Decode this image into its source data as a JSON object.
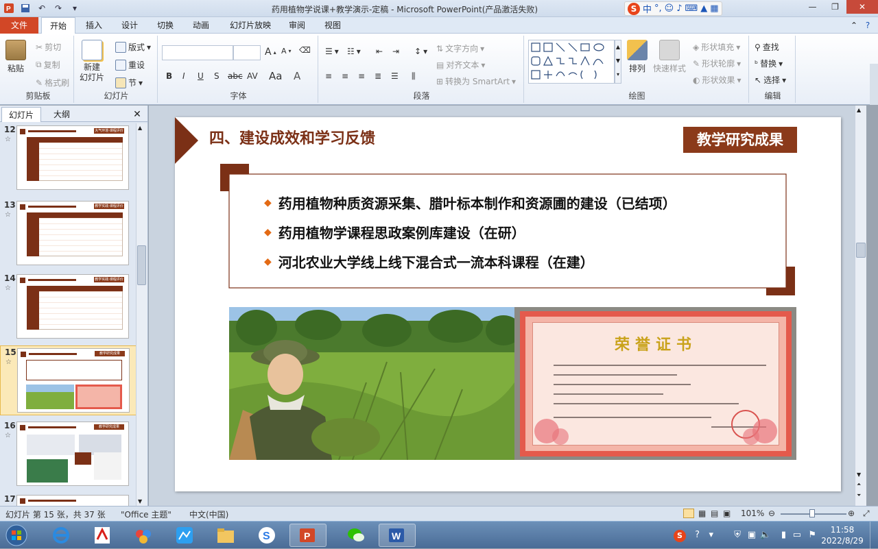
{
  "window": {
    "title": "药用植物学说课+教学演示-定稿 - Microsoft PowerPoint(产品激活失败)"
  },
  "ime": {
    "label1": "中",
    "label2": "°,"
  },
  "menu": {
    "tabs": [
      "文件",
      "开始",
      "插入",
      "设计",
      "切换",
      "动画",
      "幻灯片放映",
      "审阅",
      "视图"
    ],
    "active": "开始"
  },
  "ribbon": {
    "clipboard": {
      "paste": "粘贴",
      "cut": "剪切",
      "copy": "复制",
      "format_painter": "格式刷",
      "label": "剪贴板"
    },
    "slides": {
      "new_slide": "新建",
      "new_slide2": "幻灯片",
      "layout": "版式",
      "reset": "重设",
      "section": "节",
      "label": "幻灯片"
    },
    "font": {
      "label": "字体",
      "bold": "B",
      "italic": "I",
      "underline": "U",
      "shadow": "S",
      "strike": "abc",
      "spacing": "AV",
      "case": "Aa",
      "color": "A",
      "grow": "A",
      "shrink": "A"
    },
    "paragraph": {
      "text_direction": "文字方向",
      "align_text": "对齐文本",
      "smartart": "转换为 SmartArt",
      "label": "段落"
    },
    "drawing": {
      "arrange": "排列",
      "quick_styles": "快速样式",
      "fill": "形状填充",
      "outline": "形状轮廓",
      "effects": "形状效果",
      "label": "绘图"
    },
    "editing": {
      "find": "查找",
      "replace": "替换",
      "select": "选择",
      "label": "编辑"
    }
  },
  "left_pane": {
    "tabs": [
      "幻灯片",
      "大纲"
    ],
    "slides": [
      {
        "num": "12",
        "star": "☆",
        "selected": false,
        "badge": "大气环境·课程评价"
      },
      {
        "num": "13",
        "star": "☆",
        "selected": false,
        "badge": "教学实践·课程评价"
      },
      {
        "num": "14",
        "star": "☆",
        "selected": false,
        "badge": "教学实践·课程评价"
      },
      {
        "num": "15",
        "star": "☆",
        "selected": true,
        "badge": "教学研究成果"
      },
      {
        "num": "16",
        "star": "☆",
        "selected": false,
        "badge": "教学研究成果"
      },
      {
        "num": "17",
        "star": "☆",
        "selected": false,
        "badge": ""
      }
    ]
  },
  "slide": {
    "title": "四、建设成效和学习反馈",
    "badge": "教学研究成果",
    "bullets": [
      "药用植物种质资源采集、腊叶标本制作和资源圃的建设（已结项）",
      "药用植物学课程思政案例库建设（在研）",
      "河北农业大学线上线下混合式一流本科课程（在建）"
    ],
    "certificate_title": "荣誉证书"
  },
  "status": {
    "slide_info": "幻灯片 第 15 张，共 37 张",
    "theme": "\"Office 主题\"",
    "language": "中文(中国)",
    "zoom": "101%"
  },
  "taskbar": {
    "time": "11:58",
    "date": "2022/8/29"
  }
}
